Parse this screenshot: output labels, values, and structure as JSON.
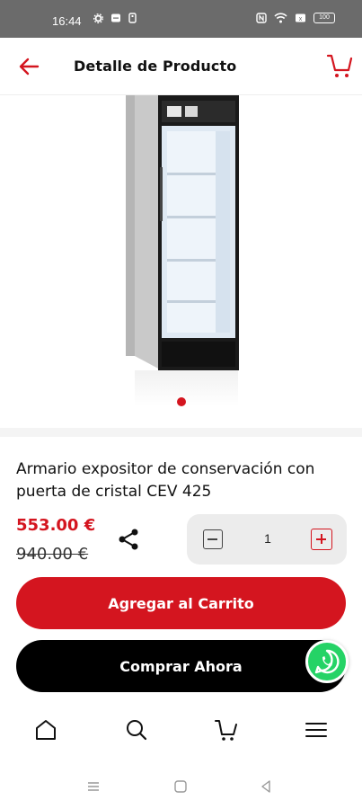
{
  "status_bar": {
    "time": "16:44",
    "battery": "100"
  },
  "header": {
    "title": "Detalle de Producto"
  },
  "product": {
    "title": "Armario expositor de conservación con puerta de cristal CEV 425",
    "price": "553.00 €",
    "old_price": "940.00 €",
    "quantity": "1",
    "carousel": {
      "active_index": 0,
      "count": 1
    }
  },
  "actions": {
    "add_to_cart": "Agregar al Carrito",
    "buy_now": "Comprar Ahora"
  },
  "bottom_nav": {
    "items": [
      {
        "icon": "home-icon"
      },
      {
        "icon": "search-icon"
      },
      {
        "icon": "cart-icon"
      },
      {
        "icon": "menu-icon"
      }
    ]
  },
  "colors": {
    "accent": "#d4151f",
    "buy_button": "#000000",
    "whatsapp": "#25d366"
  }
}
